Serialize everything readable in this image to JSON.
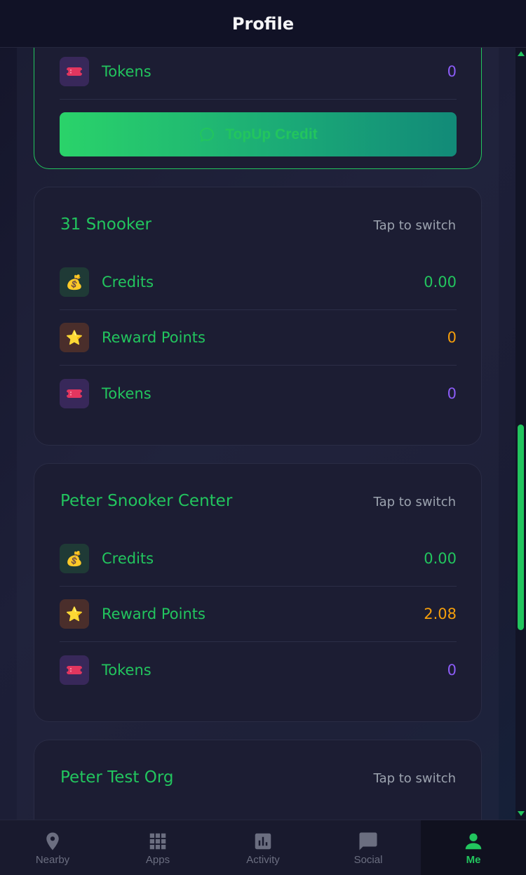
{
  "header": {
    "title": "Profile"
  },
  "active_card": {
    "tokens_label": "Tokens",
    "tokens_value": "0",
    "topup_label": "TopUp Credit"
  },
  "orgs": [
    {
      "name": "31 Snooker",
      "switch_label": "Tap to switch",
      "credits_label": "Credits",
      "credits_value": "0.00",
      "reward_label": "Reward Points",
      "reward_value": "0",
      "tokens_label": "Tokens",
      "tokens_value": "0"
    },
    {
      "name": "Peter Snooker Center",
      "switch_label": "Tap to switch",
      "credits_label": "Credits",
      "credits_value": "0.00",
      "reward_label": "Reward Points",
      "reward_value": "2.08",
      "tokens_label": "Tokens",
      "tokens_value": "0"
    },
    {
      "name": "Peter Test Org",
      "switch_label": "Tap to switch"
    }
  ],
  "icons": {
    "credits": "money-bag-icon",
    "reward": "star-icon",
    "tokens": "ticket-icon",
    "topup": "chat-bubble-icon"
  },
  "colors": {
    "accent": "#22c55e",
    "reward": "#f59e0b",
    "tokens": "#8b5cf6",
    "muted": "#9ca3af"
  },
  "nav": {
    "items": [
      {
        "label": "Nearby",
        "icon": "location-pin-icon"
      },
      {
        "label": "Apps",
        "icon": "grid-icon"
      },
      {
        "label": "Activity",
        "icon": "bar-chart-icon"
      },
      {
        "label": "Social",
        "icon": "chat-icon"
      },
      {
        "label": "Me",
        "icon": "person-icon"
      }
    ],
    "active": "Me"
  }
}
